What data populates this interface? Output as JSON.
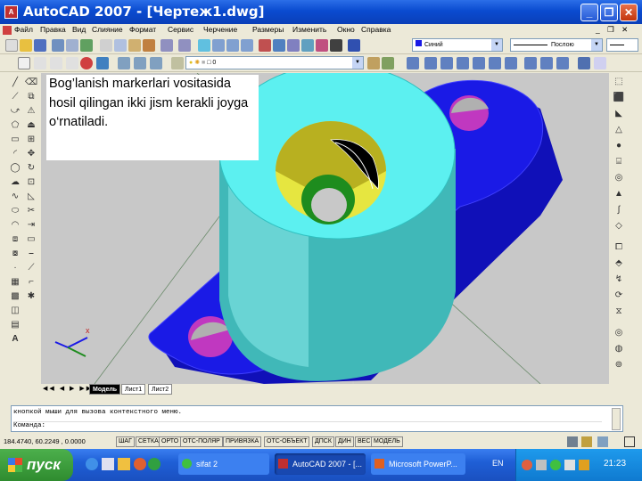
{
  "window": {
    "title": "AutoCAD 2007 - [Чертеж1.dwg]",
    "controls": {
      "minimize": "_",
      "maximize": "❐",
      "close": "✕"
    }
  },
  "menu": [
    "Файл",
    "Правка",
    "Вид",
    "Слияние",
    "Формат",
    "Сервис",
    "Черчение",
    "Размеры",
    "Изменить",
    "Окно",
    "Справка"
  ],
  "menu_controls": "_ ❐ ✕",
  "toolbar": {
    "color_value": "Синий",
    "linetype_value": "Послою",
    "layer_value": "0"
  },
  "overlay_text": "Bog’lanish markerlari vositasida hosil qilingan ikki jism kerakli joyga o‘rnatiladi.",
  "layout_tabs": [
    "Модель",
    "Лист1",
    "Лист2"
  ],
  "command": {
    "history": "кнопкой мыши для вызова контекстного меню.",
    "prompt": "Команда:"
  },
  "status": {
    "coords": "184.4740, 60.2249 , 0.0000",
    "buttons": [
      "ШАГ",
      "СЕТКА",
      "ОРТО",
      "ОТС-ПОЛЯР",
      "ПРИВЯЗКА",
      "ОТС-ОБЪЕКТ",
      "ДПСК",
      "ДИН",
      "ВЕС",
      "МОДЕЛЬ"
    ]
  },
  "taskbar": {
    "start_label": "пуск",
    "tasks": [
      "sifat 2",
      "AutoCAD 2007 - [...",
      "Microsoft PowerP..."
    ],
    "lang": "EN",
    "clock": "21:23"
  },
  "colors": {
    "title_bar": "#0a4bd0",
    "viewport_bg": "#c8c8c8",
    "flange": "#1a1ae6",
    "cylinder": "#5cf0f0",
    "bore_inner": "#e6e640",
    "hole_inner": "#c038c0",
    "bore_bottom": "#1e8c1e"
  }
}
